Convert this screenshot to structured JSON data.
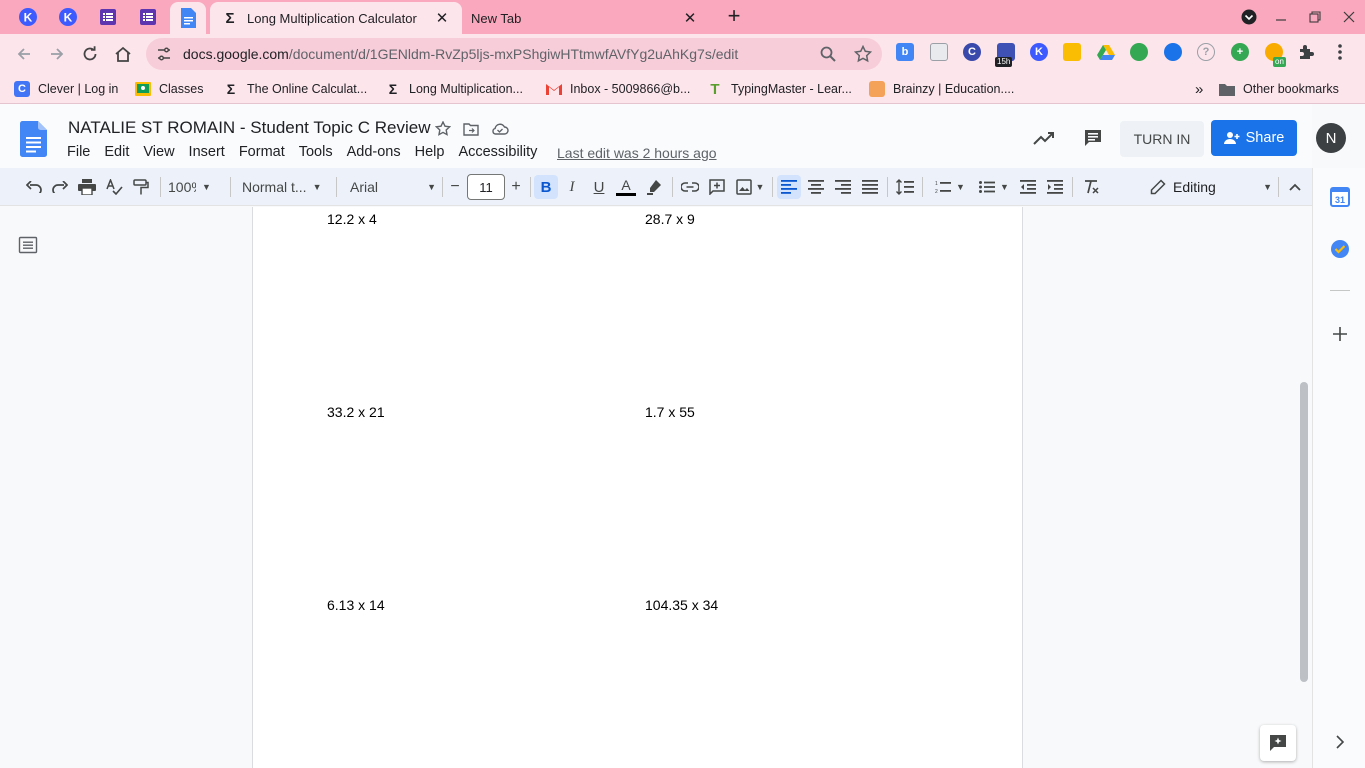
{
  "browser": {
    "tabs": [
      {
        "title": "Long Multiplication Calculator",
        "favicon": "sigma-icon",
        "active": true
      },
      {
        "title": "New Tab",
        "favicon": "",
        "active": false
      }
    ],
    "pinned_tabs": [
      {
        "icon": "kami-icon",
        "letter": "K"
      },
      {
        "icon": "kami-icon",
        "letter": "K"
      },
      {
        "icon": "list-icon",
        "letter": ""
      },
      {
        "icon": "list-icon",
        "letter": ""
      },
      {
        "icon": "docs-icon",
        "letter": ""
      }
    ],
    "url_host": "docs.google.com",
    "url_path": "/document/d/1GENldm-RvZp5ljs-mxPShgiwHTtmwfAVfYg2uAhKg7s/edit",
    "extension_badge": "15h",
    "extension_badge_on": "on",
    "bookmarks": [
      {
        "label": "Clever | Log in",
        "icon": "clever-icon"
      },
      {
        "label": "Classes",
        "icon": "classroom-icon"
      },
      {
        "label": "The Online Calculat...",
        "icon": "sigma-icon"
      },
      {
        "label": "Long Multiplication...",
        "icon": "sigma-icon"
      },
      {
        "label": "Inbox - 5009866@b...",
        "icon": "gmail-icon"
      },
      {
        "label": "TypingMaster - Lear...",
        "icon": "typingmaster-icon"
      },
      {
        "label": "Brainzy | Education....",
        "icon": "brainzy-icon"
      }
    ],
    "bookmarks_more": "»",
    "other_bookmarks": "Other bookmarks"
  },
  "docs": {
    "title": "NATALIE ST ROMAIN - Student Topic C Review",
    "menu": [
      "File",
      "Edit",
      "View",
      "Insert",
      "Format",
      "Tools",
      "Add-ons",
      "Help",
      "Accessibility"
    ],
    "last_edit": "Last edit was 2 hours ago",
    "turn_in": "TURN IN",
    "share": "Share",
    "avatar_letter": "N",
    "toolbar": {
      "zoom": "100%",
      "style": "Normal t...",
      "font": "Arial",
      "font_size": "11",
      "bold": "B",
      "italic": "I",
      "underline": "U",
      "text_color": "A",
      "mode": "Editing"
    }
  },
  "problems": [
    {
      "text": "12.2 x 4"
    },
    {
      "text": "28.7 x 9"
    },
    {
      "text": "33.2 x 21"
    },
    {
      "text": "1.7 x 55"
    },
    {
      "text": "6.13 x 14"
    },
    {
      "text": "104.35 x 34"
    }
  ],
  "colors": {
    "tabstrip": "#f9a8bd",
    "toolbar": "#fde5ec",
    "share_button": "#1a73e8",
    "docs_blue": "#4285f4"
  }
}
